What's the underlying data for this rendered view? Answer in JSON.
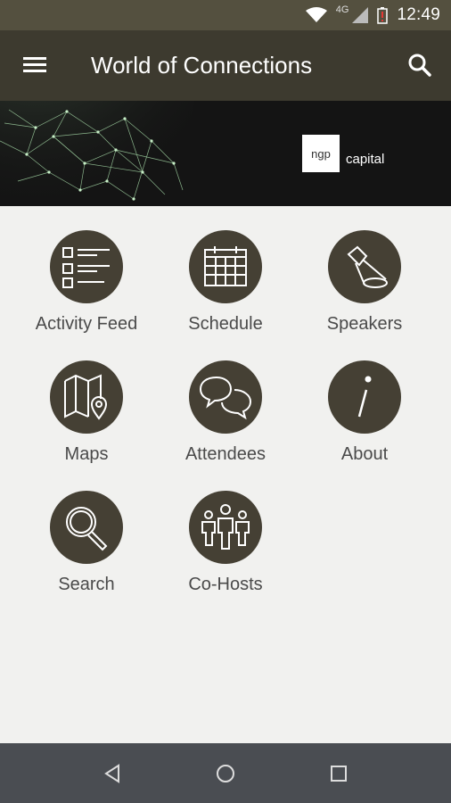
{
  "status": {
    "time": "12:49",
    "network": "4G"
  },
  "app_bar": {
    "title": "World of Connections"
  },
  "banner": {
    "logo_short": "ngp",
    "logo_text": "capital"
  },
  "tiles": [
    {
      "label": "Activity Feed",
      "icon": "list-icon"
    },
    {
      "label": "Schedule",
      "icon": "calendar-icon"
    },
    {
      "label": "Speakers",
      "icon": "spotlight-icon"
    },
    {
      "label": "Maps",
      "icon": "map-icon"
    },
    {
      "label": "Attendees",
      "icon": "chat-bubbles-icon"
    },
    {
      "label": "About",
      "icon": "info-icon"
    },
    {
      "label": "Search",
      "icon": "magnifier-icon"
    },
    {
      "label": "Co-Hosts",
      "icon": "group-icon"
    }
  ],
  "colors": {
    "app_bar": "#3d3a2f",
    "status_bar": "#54503f",
    "icon_circle": "#454034",
    "background": "#f1f1ef",
    "nav_bar": "#4a4d52"
  }
}
